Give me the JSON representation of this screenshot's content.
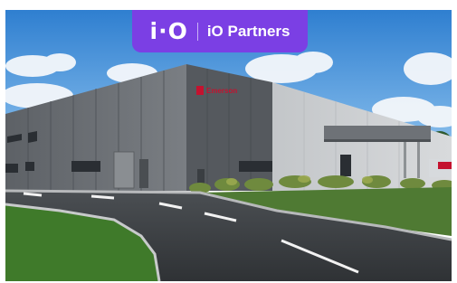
{
  "badge": {
    "logo_text": "i·O",
    "brand_name": "iO Partners",
    "color": "#7b3fe4"
  },
  "scene": {
    "building_sign": "Emerson",
    "sign_color": "#c4122f"
  }
}
